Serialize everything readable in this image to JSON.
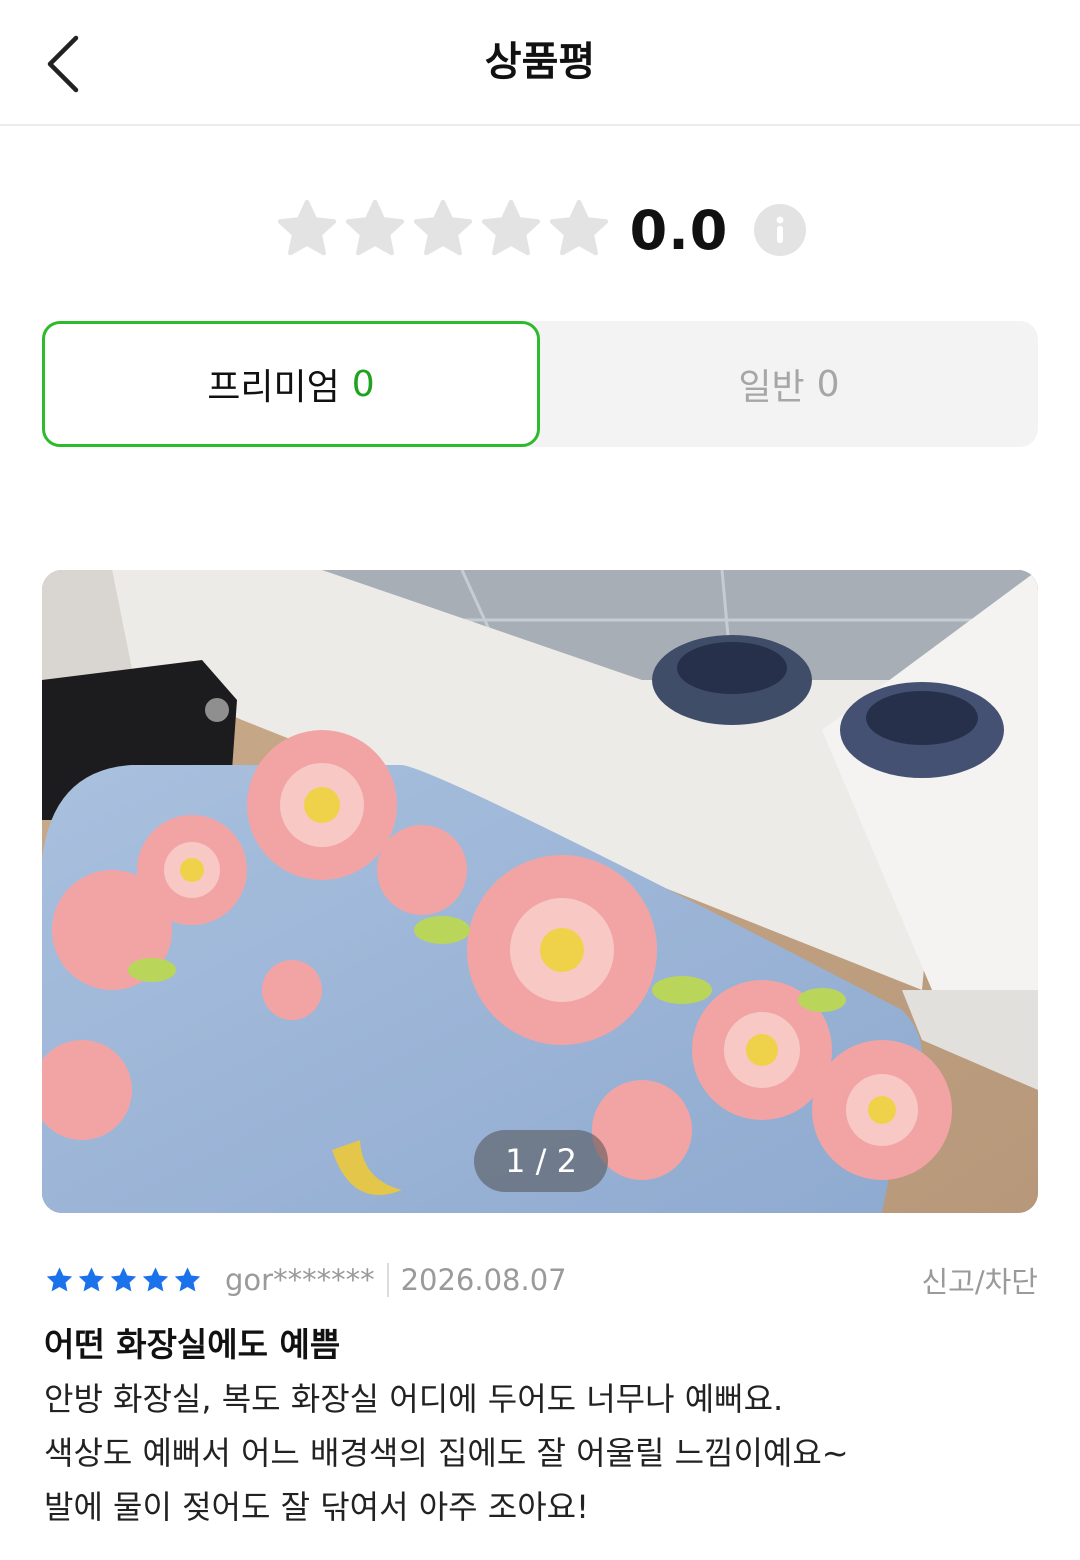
{
  "header": {
    "title": "상품평",
    "back_icon": "chevron-left-icon"
  },
  "rating": {
    "average": "0.0",
    "star_count": 5,
    "star_color": "#e3e3e3",
    "info_icon": "info-icon"
  },
  "tabs": {
    "premium": {
      "label": "프리미엄",
      "count": "0",
      "active": true,
      "accent": "#2dbb2d"
    },
    "general": {
      "label": "일반",
      "count": "0",
      "active": false
    }
  },
  "review": {
    "image_indicator": "1 / 2",
    "rating": 5,
    "star_color": "#1a73ea",
    "reviewer": "gor*******",
    "date": "2026.08.07",
    "report_label": "신고/차단",
    "title": "어떤 화장실에도 예쁨",
    "body": [
      "안방 화장실, 복도 화장실 어디에 두어도 너무나 예뻐요.",
      "색상도 예뻐서 어느 배경색의 집에도 잘 어울릴 느낌이예요~",
      "발에 물이 젖어도 잘 닦여서 아주 조아요!"
    ]
  }
}
